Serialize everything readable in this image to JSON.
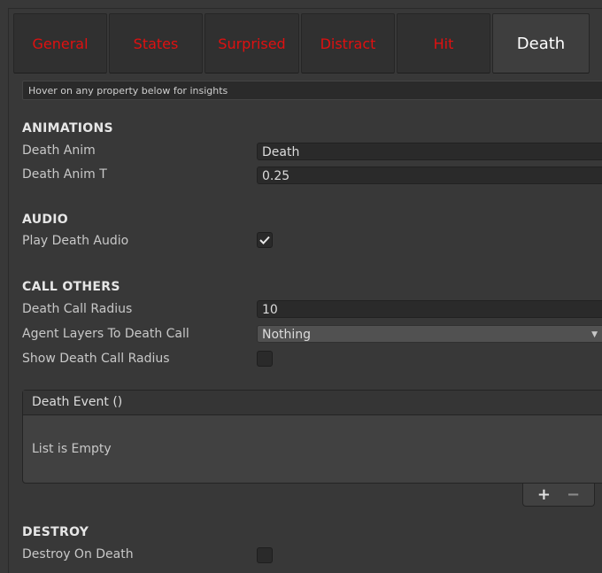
{
  "tabs": [
    {
      "label": "General"
    },
    {
      "label": "States"
    },
    {
      "label": "Surprised"
    },
    {
      "label": "Distract"
    },
    {
      "label": "Hit"
    },
    {
      "label": "Death"
    }
  ],
  "hint": "Hover on any property below for insights",
  "animations": {
    "title": "ANIMATIONS",
    "death_anim_label": "Death Anim",
    "death_anim_value": "Death",
    "death_anim_t_label": "Death Anim T",
    "death_anim_t_value": "0.25"
  },
  "audio": {
    "title": "AUDIO",
    "play_death_audio_label": "Play Death Audio",
    "play_death_audio_checked": true
  },
  "call_others": {
    "title": "CALL OTHERS",
    "radius_label": "Death Call Radius",
    "radius_value": "10",
    "layers_label": "Agent Layers To Death Call",
    "layers_value": "Nothing",
    "show_radius_label": "Show Death Call Radius",
    "show_radius_checked": false
  },
  "death_event": {
    "header": "Death Event ()",
    "empty": "List is Empty",
    "add": "+",
    "remove": "−"
  },
  "destroy": {
    "title": "DESTROY",
    "destroy_label": "Destroy On Death",
    "destroy_checked": false
  },
  "colors": {
    "inactive_tab_text": "#e01010",
    "active_tab_text": "#ffffff",
    "background": "#383838"
  }
}
